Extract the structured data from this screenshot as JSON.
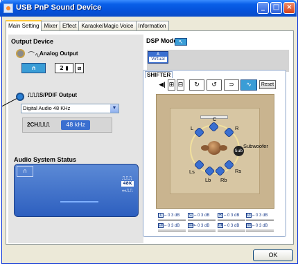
{
  "window": {
    "title": "USB PnP Sound Device"
  },
  "tabs": [
    "Main Setting",
    "Mixer",
    "Effect",
    "Karaoke/Magic Voice",
    "Information"
  ],
  "output_device": {
    "title": "Output Device",
    "analog_label": "Analog Output",
    "analog_btn_2": "2",
    "spdif_label": "S/PDIF Output",
    "select_value": "Digital Audio 48 KHz",
    "ch_label": "2CH",
    "khz_label": "48 kHz"
  },
  "audio_status": {
    "title": "Audio System Status",
    "rate_badge": "48K"
  },
  "dsp": {
    "title": "DSP Mode",
    "virtual_top": "A",
    "virtual_label": "Virtual"
  },
  "shifter": {
    "tab_label": "SHIFTER",
    "reset_label": "Reset",
    "speakers": {
      "c": "C",
      "l": "L",
      "r": "R",
      "ls": "Ls",
      "rs": "Rs",
      "lb": "Lb",
      "rb": "Rb",
      "sub": "Sub",
      "subwoofer": "Subwoofer"
    },
    "levels": [
      {
        "tag": "L",
        "value": "– 0 3 dB"
      },
      {
        "tag": "C",
        "value": "– 0 3 dB"
      },
      {
        "tag": "R",
        "value": "– 0 3 dB"
      },
      {
        "tag": "Ls",
        "value": "– 0 3 dB"
      },
      {
        "tag": "Lb",
        "value": "– 0 3 dB"
      },
      {
        "tag": "Sub",
        "value": "– 0 3 dB"
      },
      {
        "tag": "Rb",
        "value": "– 0 3 dB"
      },
      {
        "tag": "Rs",
        "value": "– 0 3 dB"
      }
    ]
  },
  "footer": {
    "ok_label": "OK"
  }
}
